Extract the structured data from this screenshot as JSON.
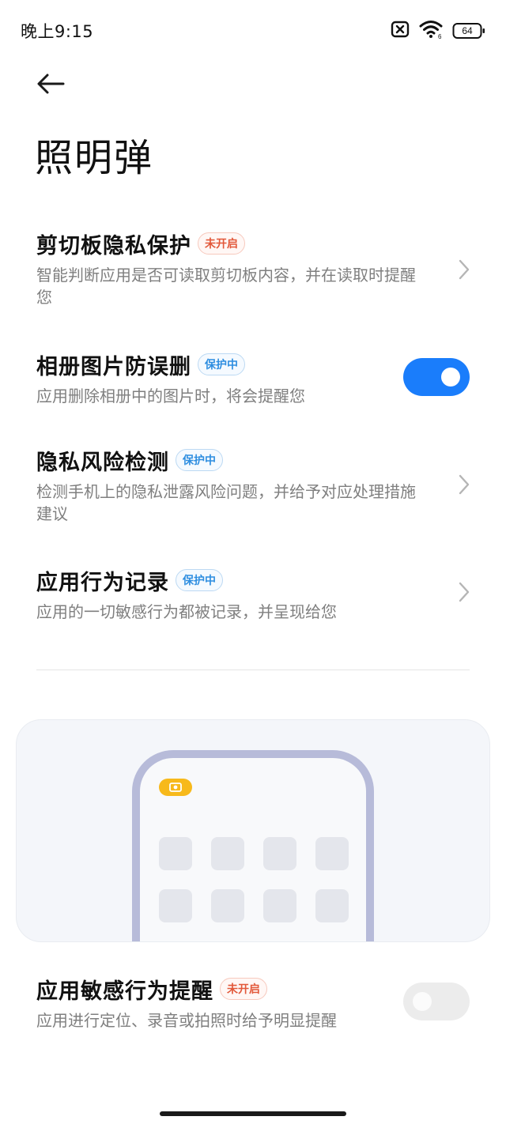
{
  "status_bar": {
    "time": "晚上9:15",
    "battery_level": "64",
    "icons": [
      "sim-off-icon",
      "wifi-icon",
      "battery-icon"
    ]
  },
  "header": {
    "back_icon": "arrow-left-icon",
    "title": "照明弹"
  },
  "settings": [
    {
      "title": "剪切板隐私保护",
      "badge": "未开启",
      "badge_state": "off",
      "description": "智能判断应用是否可读取剪切板内容，并在读取时提醒您",
      "control": "chevron"
    },
    {
      "title": "相册图片防误删",
      "badge": "保护中",
      "badge_state": "on",
      "description": "应用删除相册中的图片时，将会提醒您",
      "control": "toggle",
      "toggle_on": true
    },
    {
      "title": "隐私风险检测",
      "badge": "保护中",
      "badge_state": "on",
      "description": "检测手机上的隐私泄露风险问题，并给予对应处理措施建议",
      "control": "chevron"
    },
    {
      "title": "应用行为记录",
      "badge": "保护中",
      "badge_state": "on",
      "description": "应用的一切敏感行为都被记录，并呈现给您",
      "control": "chevron"
    }
  ],
  "sensitive_reminder": {
    "title": "应用敏感行为提醒",
    "badge": "未开启",
    "badge_state": "off",
    "description": "应用进行定位、录音或拍照时给予明显提醒",
    "control": "toggle",
    "toggle_on": false
  },
  "colors": {
    "accent": "#1a7dfb",
    "badge_off": "#e2583a",
    "badge_on": "#2f8ee0",
    "camera_indicator": "#f7b91b",
    "phone_frame": "#b7bbd9"
  }
}
